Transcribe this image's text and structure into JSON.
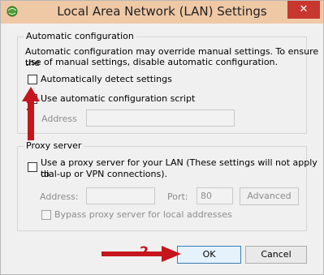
{
  "window": {
    "title": "Local Area Network (LAN) Settings",
    "close_label": "✕"
  },
  "auto_config": {
    "legend": "Automatic configuration",
    "description_line1": "Automatic configuration may override manual settings.  To ensure the",
    "description_line2": "use of manual settings, disable automatic configuration.",
    "auto_detect_label": "Automatically detect settings",
    "auto_detect_checked": false,
    "script_label": "Use automatic configuration script",
    "script_checked": false,
    "address_label": "Address",
    "address_value": ""
  },
  "proxy": {
    "legend": "Proxy server",
    "use_proxy_line1": "Use a proxy server for your LAN (These settings will not apply to",
    "use_proxy_line2": "dial-up or VPN connections).",
    "use_proxy_checked": false,
    "address_label": "Address:",
    "address_value": "",
    "port_label": "Port:",
    "port_value": "80",
    "advanced_label": "Advanced",
    "bypass_label": "Bypass proxy server for local addresses",
    "bypass_checked": false
  },
  "buttons": {
    "ok_label": "OK",
    "cancel_label": "Cancel"
  },
  "annotations": {
    "marker1": "1",
    "marker2": "2",
    "color": "#c4161c"
  }
}
